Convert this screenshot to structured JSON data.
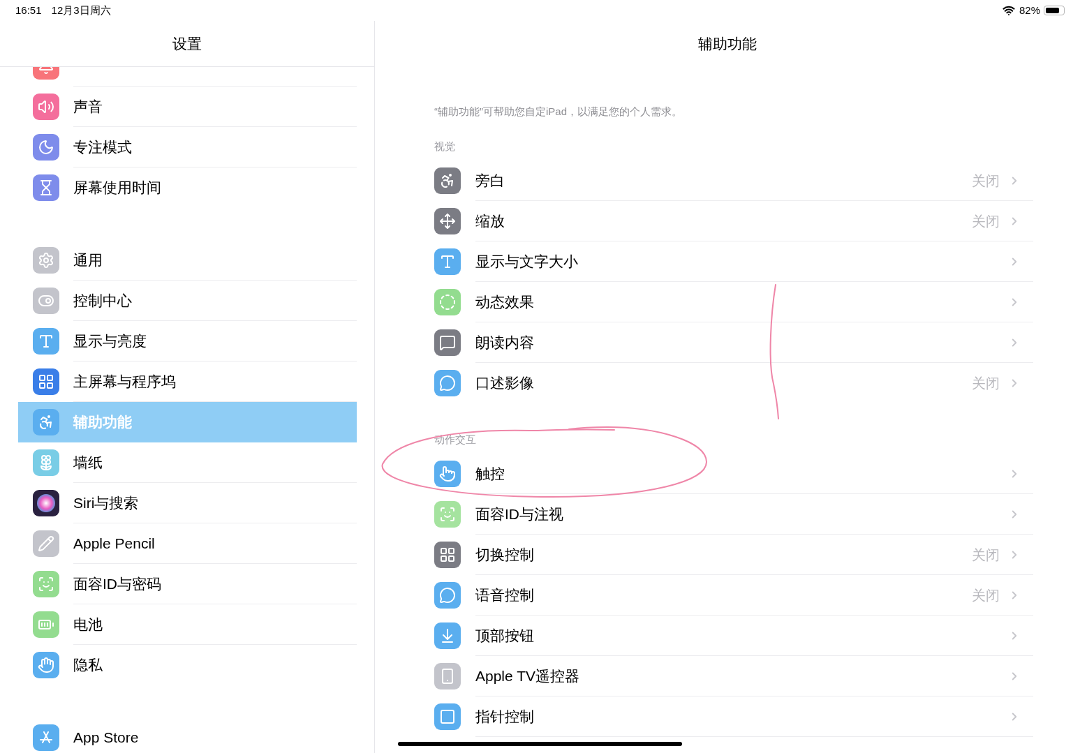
{
  "status_bar": {
    "time": "16:51",
    "date": "12月3日周六",
    "battery": "82%"
  },
  "sidebar": {
    "title": "设置",
    "groups": [
      {
        "items": [
          {
            "selected": false
          },
          {
            "label": "声音",
            "selected": false
          },
          {
            "label": "专注模式",
            "selected": false
          },
          {
            "label": "屏幕使用时间",
            "selected": false
          }
        ]
      },
      {
        "items": [
          {
            "label": "通用",
            "selected": false
          },
          {
            "label": "控制中心",
            "selected": false
          },
          {
            "label": "显示与亮度",
            "selected": false
          },
          {
            "label": "主屏幕与程序坞",
            "selected": false
          },
          {
            "label": "辅助功能",
            "selected": true
          },
          {
            "label": "墙纸",
            "selected": false
          },
          {
            "label": "Siri与搜索",
            "selected": false
          },
          {
            "label": "Apple Pencil",
            "selected": false
          },
          {
            "label": "面容ID与密码",
            "selected": false
          },
          {
            "label": "电池",
            "selected": false
          },
          {
            "label": "隐私",
            "selected": false
          }
        ]
      },
      {
        "items": [
          {
            "label": "App Store",
            "selected": false
          }
        ]
      }
    ]
  },
  "detail": {
    "title": "辅助功能",
    "description": "“辅助功能”可帮助您自定iPad，以满足您的个人需求。",
    "sections": [
      {
        "header": "视觉",
        "rows": [
          {
            "label": "旁白",
            "value": "关闭"
          },
          {
            "label": "缩放",
            "value": "关闭"
          },
          {
            "label": "显示与文字大小"
          },
          {
            "label": "动态效果"
          },
          {
            "label": "朗读内容"
          },
          {
            "label": "口述影像",
            "value": "关闭"
          }
        ]
      },
      {
        "header": "动作交互",
        "rows": [
          {
            "label": "触控"
          },
          {
            "label": "面容ID与注视"
          },
          {
            "label": "切换控制",
            "value": "关闭"
          },
          {
            "label": "语音控制",
            "value": "关闭"
          },
          {
            "label": "顶部按钮"
          },
          {
            "label": "Apple TV遥控器"
          },
          {
            "label": "指针控制"
          }
        ]
      }
    ]
  }
}
